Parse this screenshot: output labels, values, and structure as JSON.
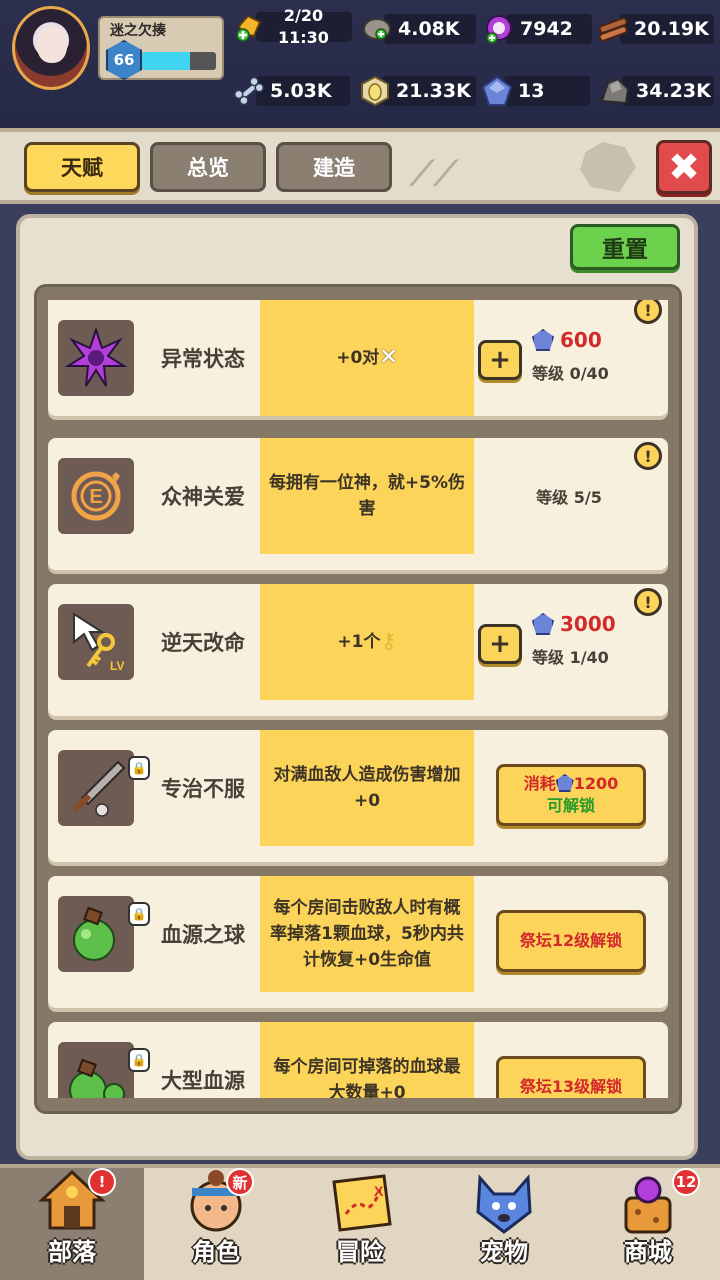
{
  "player": {
    "name": "迷之欠揍",
    "level": "66",
    "xp_progress": 0.65
  },
  "resources": {
    "stamina": {
      "icon": "stamina-icon",
      "value": "2/20",
      "timer": "11:30"
    },
    "stone": {
      "icon": "stone-icon",
      "value": "4.08K"
    },
    "purple_orb": {
      "icon": "purple-orb-icon",
      "value": "7942"
    },
    "wood": {
      "icon": "wood-icon",
      "value": "20.19K"
    },
    "bone": {
      "icon": "bone-icon",
      "value": "5.03K"
    },
    "egg_coin": {
      "icon": "egg-coin-icon",
      "value": "21.33K"
    },
    "gem": {
      "icon": "gem-icon",
      "value": "13"
    },
    "ore": {
      "icon": "ore-icon",
      "value": "34.23K"
    }
  },
  "tabs": [
    {
      "label": "天赋",
      "active": true
    },
    {
      "label": "总览",
      "active": false
    },
    {
      "label": "建造",
      "active": false
    }
  ],
  "close_icon": "close-icon",
  "reset_label": "重置",
  "talents": [
    {
      "name": "异常状态",
      "icon": "status-effect-icon",
      "desc": "+0对",
      "desc_icon": "crossed-swords-icon",
      "cost": "600",
      "level": "等级 0/40",
      "state": "upgradable"
    },
    {
      "name": "众神关爱",
      "icon": "god-favor-icon",
      "desc": "每拥有一位神，就+5%伤害",
      "level": "等级 5/5",
      "state": "maxed"
    },
    {
      "name": "逆天改命",
      "icon": "fate-key-icon",
      "desc": "+1个",
      "desc_icon": "key-icon",
      "cost": "3000",
      "level": "等级 1/40",
      "state": "upgradable"
    },
    {
      "name": "专治不服",
      "icon": "sword-icon",
      "desc": "对满血敌人造成伤害增加+0",
      "unlock_cost_prefix": "消耗",
      "unlock_cost": "1200",
      "unlock_label": "可解锁",
      "state": "unlockable"
    },
    {
      "name": "血源之球",
      "icon": "blood-orb-icon",
      "desc": "每个房间击败敌人时有概率掉落1颗血球，5秒内共计恢复+0生命值",
      "unlock_label": "祭坛12级解锁",
      "state": "locked"
    },
    {
      "name": "大型血源",
      "icon": "large-blood-orb-icon",
      "desc": "每个房间可掉落的血球最大数量+0",
      "unlock_label": "祭坛13级解锁",
      "state": "locked"
    }
  ],
  "bottom_nav": [
    {
      "label": "部落",
      "icon": "tribe-icon",
      "active": true,
      "badge": "!"
    },
    {
      "label": "角色",
      "icon": "character-icon",
      "active": false,
      "badge": "新"
    },
    {
      "label": "冒险",
      "icon": "adventure-map-icon",
      "active": false,
      "badge": ""
    },
    {
      "label": "宠物",
      "icon": "pet-icon",
      "active": false,
      "badge": ""
    },
    {
      "label": "商城",
      "icon": "shop-icon",
      "active": false,
      "badge": "12"
    }
  ],
  "colors": {
    "accent_yellow": "#fcd45a",
    "reset_green": "#6cd24e",
    "close_red": "#e24b4b",
    "cost_red": "#d3292b",
    "badge_red": "#e03232",
    "unlock_green": "#2a9a2a"
  }
}
